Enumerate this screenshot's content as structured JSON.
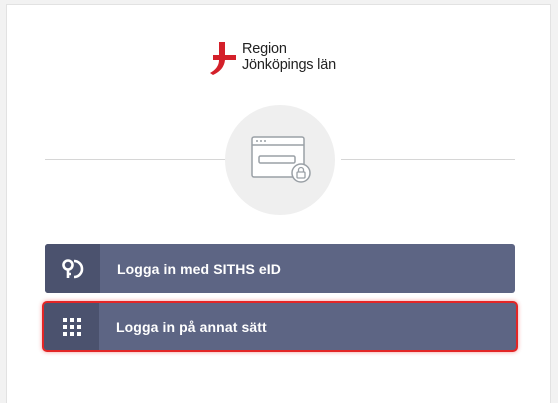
{
  "brand": {
    "line1": "Region",
    "line2": "Jönköpings län",
    "accent_color": "#d4202a"
  },
  "hero": {
    "icon": "browser-password-window-icon"
  },
  "buttons": {
    "siths": {
      "label": "Logga in med SITHS eID",
      "icon": "siths-card-icon"
    },
    "other": {
      "label": "Logga in på annat sätt",
      "icon": "grid-dots-icon",
      "focused": true
    }
  },
  "colors": {
    "button_bg": "#5d6584",
    "button_icon_bg": "#4b526e",
    "focus_ring": "#e32626"
  }
}
